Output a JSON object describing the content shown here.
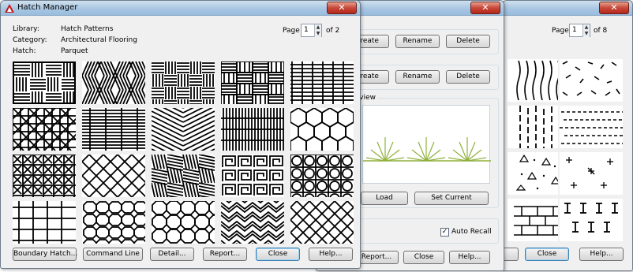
{
  "window_right": {
    "page_label": "Page",
    "page_value": "1",
    "page_of": "of 8",
    "close_label": "Close",
    "help_label": "Help...",
    "partial_button_label": ""
  },
  "window_middle": {
    "row1": {
      "create_label": "Create",
      "rename_label": "Rename",
      "delete_label": "Delete"
    },
    "row2": {
      "create_label": "Create",
      "rename_label": "Rename",
      "delete_label": "Delete"
    },
    "preview_label": "Preview",
    "load_label": "Load",
    "set_current_label": "Set Current",
    "auto_recall_label": "Auto Recall",
    "auto_recall_checked": true,
    "report_label": "Report...",
    "close_label": "Close",
    "help_label": "Help..."
  },
  "window_main": {
    "title": "Hatch Manager",
    "fields": [
      {
        "label": "Library:",
        "value": "Hatch Patterns"
      },
      {
        "label": "Category:",
        "value": "Architectural Flooring"
      },
      {
        "label": "Hatch:",
        "value": "Parquet"
      }
    ],
    "page_label": "Page",
    "page_value": "1",
    "page_of": "of 2",
    "patterns": [
      {
        "icon": "parquet-pattern-icon",
        "style": "parquet"
      },
      {
        "icon": "herringbone-pattern-icon",
        "style": "diag"
      },
      {
        "icon": "basketweave-pattern-icon",
        "style": "basket"
      },
      {
        "icon": "weave-pattern-icon",
        "style": "weave"
      },
      {
        "icon": "ladder-pattern-icon",
        "style": "ladder"
      },
      {
        "icon": "lattice-pattern-icon",
        "style": "lattice"
      },
      {
        "icon": "stripes-pattern-icon",
        "style": "hstripe"
      },
      {
        "icon": "chevron-pattern-icon",
        "style": "chevron"
      },
      {
        "icon": "brick-pattern-icon",
        "style": "vbrick"
      },
      {
        "icon": "hex-tile-pattern-icon",
        "style": "hexgrid"
      },
      {
        "icon": "star-tile-pattern-icon",
        "style": "stars"
      },
      {
        "icon": "octagon-pattern-icon",
        "style": "diamonds"
      },
      {
        "icon": "diagonal-weave-pattern-icon",
        "style": "diagweave"
      },
      {
        "icon": "greek-key-pattern-icon",
        "style": "greek"
      },
      {
        "icon": "circle-tile-pattern-icon",
        "style": "circles"
      },
      {
        "icon": "grid-pattern-icon",
        "style": "grid"
      },
      {
        "icon": "octagon-mesh-pattern-icon",
        "style": "octmesh"
      },
      {
        "icon": "octagon-square-pattern-icon",
        "style": "octsquare"
      },
      {
        "icon": "basket-3d-pattern-icon",
        "style": "zig"
      },
      {
        "icon": "diamond-mesh-pattern-icon",
        "style": "diamesh"
      }
    ],
    "buttons": {
      "boundary_hatch": "Boundary Hatch...",
      "command_line": "Command Line",
      "detail": "Detail...",
      "report": "Report...",
      "close": "Close",
      "help": "Help..."
    }
  }
}
